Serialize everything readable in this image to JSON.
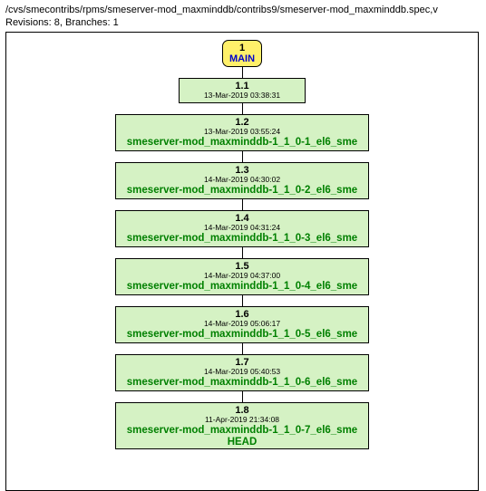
{
  "header": {
    "path": "/cvs/smecontribs/rpms/smeserver-mod_maxminddb/contribs9/smeserver-mod_maxminddb.spec,v",
    "revisions_label": "Revisions: 8, Branches: 1"
  },
  "branch": {
    "num": "1",
    "name": "MAIN"
  },
  "revisions": [
    {
      "ver": "1.1",
      "date": "13-Mar-2019 03:38:31",
      "tag": ""
    },
    {
      "ver": "1.2",
      "date": "13-Mar-2019 03:55:24",
      "tag": "smeserver-mod_maxminddb-1_1_0-1_el6_sme"
    },
    {
      "ver": "1.3",
      "date": "14-Mar-2019 04:30:02",
      "tag": "smeserver-mod_maxminddb-1_1_0-2_el6_sme"
    },
    {
      "ver": "1.4",
      "date": "14-Mar-2019 04:31:24",
      "tag": "smeserver-mod_maxminddb-1_1_0-3_el6_sme"
    },
    {
      "ver": "1.5",
      "date": "14-Mar-2019 04:37:00",
      "tag": "smeserver-mod_maxminddb-1_1_0-4_el6_sme"
    },
    {
      "ver": "1.6",
      "date": "14-Mar-2019 05:06:17",
      "tag": "smeserver-mod_maxminddb-1_1_0-5_el6_sme"
    },
    {
      "ver": "1.7",
      "date": "14-Mar-2019 05:40:53",
      "tag": "smeserver-mod_maxminddb-1_1_0-6_el6_sme"
    },
    {
      "ver": "1.8",
      "date": "11-Apr-2019 21:34:08",
      "tag": "smeserver-mod_maxminddb-1_1_0-7_el6_sme",
      "extra": "HEAD"
    }
  ]
}
